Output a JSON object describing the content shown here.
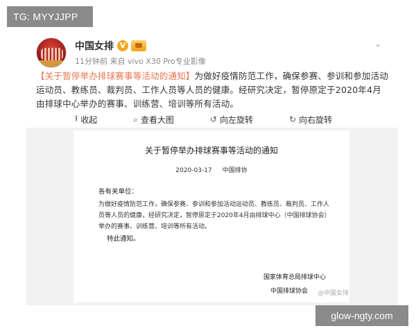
{
  "overlay": {
    "tg_label": "TG: MYYJJPP",
    "site_label": "glow-ngty.com"
  },
  "post": {
    "author": "中国女排",
    "verified_icon": "verified-v-icon",
    "vip_icon": "vip-crown-icon",
    "meta": "11分钟前 来自 vivo X30 Pro专业影像",
    "text_link": "【关于暂停举办排球赛事等活动的通知】",
    "text_body": "为做好疫情防范工作，确保参赛、参训和参加活动运动员、教练员、裁判员、工作人员等人员的健康。经研究决定，暂停原定于2020年4月由排球中心举办的赛事、训练营、培训等所有活动。"
  },
  "toolbar": {
    "collapse": "收起",
    "view_large": "查看大图",
    "rotate_left": "向左旋转",
    "rotate_right": "向右旋转"
  },
  "document": {
    "title": "关于暂停举办排球赛事等活动的通知",
    "date": "2020-03-17",
    "source": "中国排协",
    "greeting": "各有关单位：",
    "body": "为做好疫情防范工作，确保参赛、参训和参加活动运动员、教练员、裁判员、工作人员等人员的健康，经研究决定，暂停原定于2020年4月由排球中心（中国排球协会）举办的赛事、训练营、培训等所有活动。",
    "notice": "特此通知。",
    "signature_1": "国家体育总局排球中心",
    "signature_2": "中国排球协会"
  },
  "watermark": "@中国女排",
  "colors": {
    "link": "#eb7350",
    "badge_bg": "#8a8a8a",
    "doc_bg": "#f2f2f2"
  }
}
